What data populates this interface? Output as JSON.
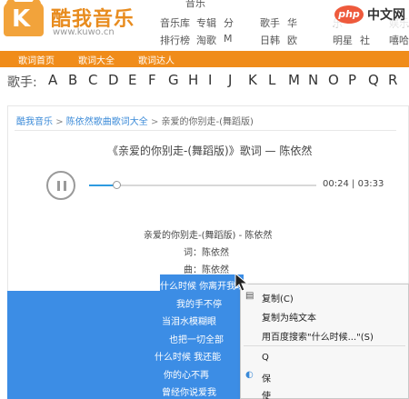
{
  "header": {
    "logo_title": "酷我音乐",
    "logo_url": "www.kuwo.cn",
    "nav_row1": [
      "音乐库",
      "专辑",
      "分",
      "歌手",
      "华",
      "乐",
      "娱乐"
    ],
    "nav_row2": [
      "排行榜",
      "淘歌",
      "M",
      "日韩",
      "欧",
      "明星",
      "社",
      "嘻哈"
    ],
    "nav_top_partial": "音乐"
  },
  "orange_nav": [
    "歌词首页",
    "歌词大全",
    "歌词达人"
  ],
  "letters": {
    "label": "歌手:",
    "items": [
      "A",
      "B",
      "C",
      "D",
      "E",
      "F",
      "G",
      "H",
      "I",
      "J",
      "K",
      "L",
      "M",
      "N",
      "O",
      "P",
      "Q",
      "R"
    ]
  },
  "breadcrumb": {
    "home": "酷我音乐",
    "sep": ">",
    "mid": "陈依然歌曲歌词大全",
    "current": "亲爱的你别走-(舞蹈版)"
  },
  "song": {
    "title": "《亲爱的你别走-(舞蹈版)》歌词 — 陈依然"
  },
  "player": {
    "current_time": "00:24",
    "separator": "|",
    "total_time": "03:33",
    "progress": 0.12
  },
  "lyrics": {
    "plain": [
      "亲爱的你别走-(舞蹈版) - 陈依然",
      "词：陈依然",
      "曲：陈依然"
    ],
    "selected": [
      "什么时候 你离开我以后",
      "我的手不停",
      "当泪水模糊眼",
      "也把一切全部",
      "什么时候 我还能",
      "你的心不再",
      "曾经你说爱我"
    ]
  },
  "context_menu": {
    "items": [
      {
        "label": "复制(C)",
        "icon": "copy-icon"
      },
      {
        "label": "复制为纯文本",
        "icon": ""
      },
      {
        "label": "用百度搜索\"什么时候...\"(S)",
        "icon": ""
      },
      {
        "label": "Q",
        "icon": ""
      },
      {
        "label": "保",
        "icon": "save-icon"
      },
      {
        "label": "使",
        "icon": ""
      }
    ]
  },
  "watermark": {
    "badge": "php",
    "text": "中文网"
  },
  "colors": {
    "orange": "#f08c1a",
    "link": "#3a8ad8",
    "selection": "#3c8de5",
    "progress": "#2e9be0"
  }
}
